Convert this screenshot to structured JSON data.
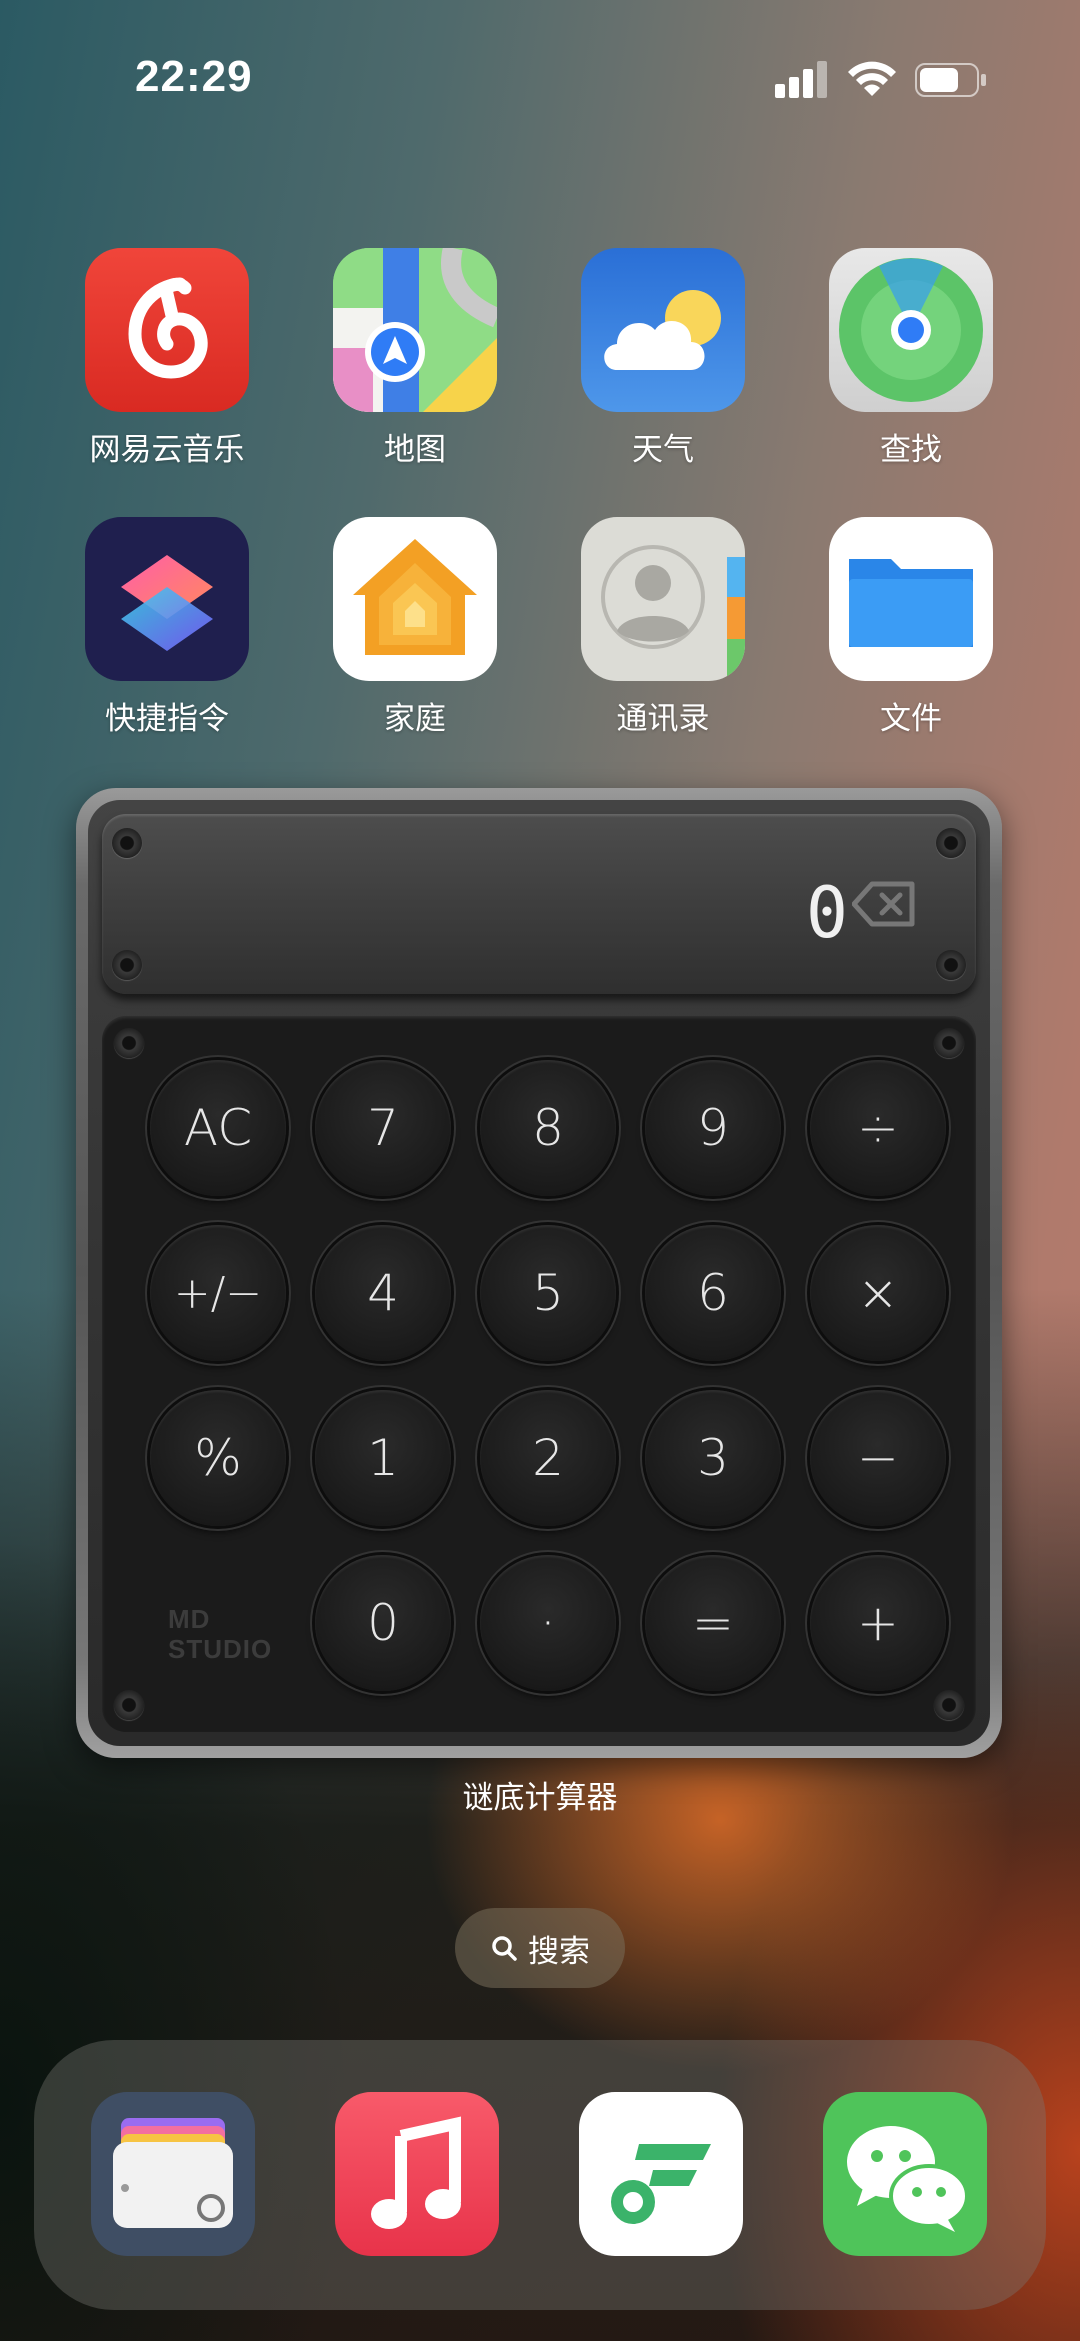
{
  "status_bar": {
    "time": "22:29"
  },
  "apps": [
    {
      "label": "网易云音乐",
      "icon": "netease-music-icon"
    },
    {
      "label": "地图",
      "icon": "maps-icon"
    },
    {
      "label": "天气",
      "icon": "weather-icon"
    },
    {
      "label": "查找",
      "icon": "find-my-icon"
    },
    {
      "label": "快捷指令",
      "icon": "shortcuts-icon"
    },
    {
      "label": "家庭",
      "icon": "home-icon"
    },
    {
      "label": "通讯录",
      "icon": "contacts-icon"
    },
    {
      "label": "文件",
      "icon": "files-icon"
    }
  ],
  "calculator": {
    "display_value": "0",
    "brand_line1": "MD",
    "brand_line2": "STUDIO",
    "keys": [
      "AC",
      "7",
      "8",
      "9",
      "÷",
      "+/−",
      "4",
      "5",
      "6",
      "×",
      "%",
      "1",
      "2",
      "3",
      "−",
      "0",
      "·",
      "=",
      "+"
    ],
    "widget_label": "谜底计算器"
  },
  "search": {
    "label": "搜索"
  },
  "dock": [
    "wallet-icon",
    "music-icon",
    "fluent-app-icon",
    "wechat-icon"
  ]
}
